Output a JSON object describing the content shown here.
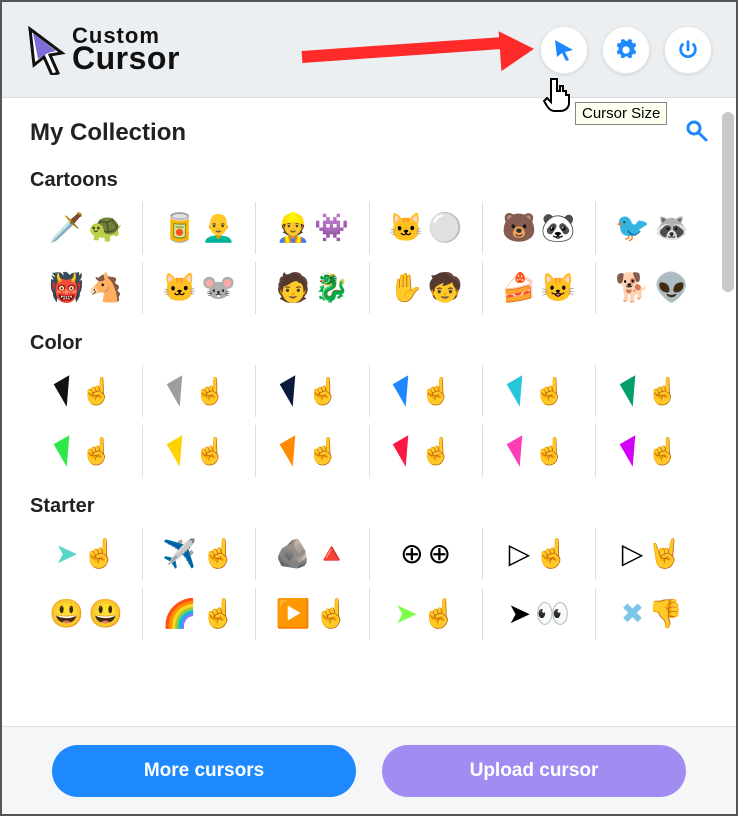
{
  "header": {
    "logo_top": "Custom",
    "logo_bottom": "Cursor",
    "tooltip": "Cursor Size"
  },
  "page": {
    "title": "My Collection"
  },
  "sections": [
    {
      "heading": "Cartoons",
      "rows": 2,
      "cols": 6
    },
    {
      "heading": "Color",
      "rows": 2,
      "cols": 6,
      "palette_row1": [
        "#111111",
        "#9e9e9e",
        "#0b1a3a",
        "#1e88ff",
        "#26c6da",
        "#009e6a"
      ],
      "palette_row2": [
        "#2ee84a",
        "#ffd200",
        "#ff8a00",
        "#ff1744",
        "#ff3db5",
        "#d500f9"
      ]
    },
    {
      "heading": "Starter",
      "rows": 2,
      "cols": 6
    }
  ],
  "footer": {
    "more_label": "More cursors",
    "upload_label": "Upload cursor"
  }
}
